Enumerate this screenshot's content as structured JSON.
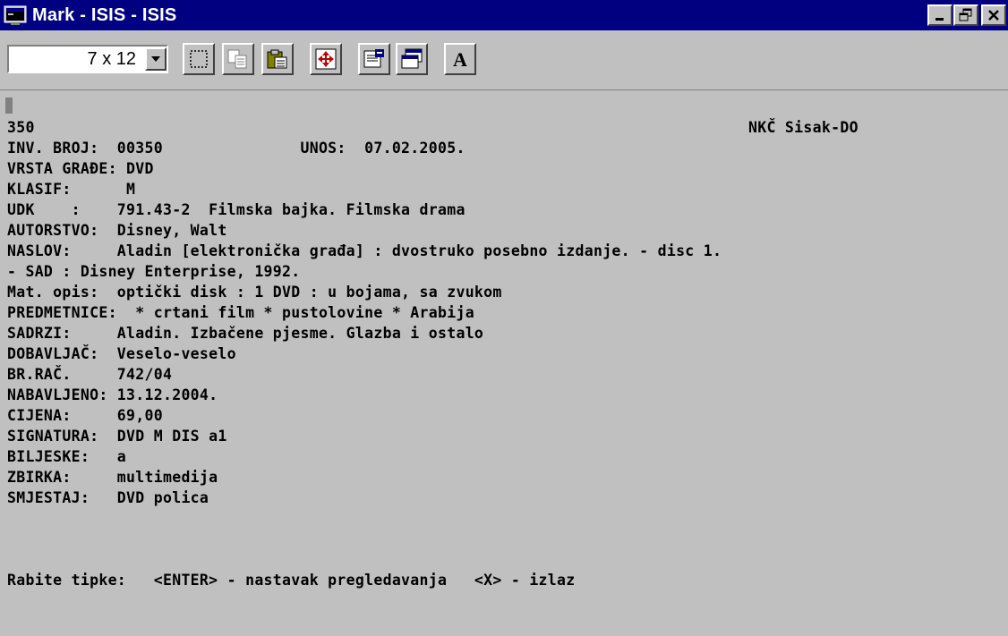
{
  "window": {
    "title": "Mark - ISIS - ISIS",
    "icon": "dos-window-icon"
  },
  "toolbar": {
    "font_size_value": "7 x 12",
    "buttons": [
      {
        "icon": "mark-select-icon"
      },
      {
        "icon": "copy-icon"
      },
      {
        "icon": "paste-icon"
      },
      {
        "icon": "fullscreen-icon"
      },
      {
        "icon": "properties-icon"
      },
      {
        "icon": "background-icon"
      },
      {
        "icon": "font-icon",
        "label": "A"
      }
    ]
  },
  "record": {
    "header_left": "350",
    "header_right": "NKČ Sisak-DO",
    "lines": [
      "INV. BROJ:  00350               UNOS:  07.02.2005.",
      "VRSTA GRAĐE: DVD",
      "KLASIF:      M",
      "UDK    :    791.43-2  Filmska bajka. Filmska drama",
      "AUTORSTVO:  Disney, Walt",
      "NASLOV:     Aladin [elektronička građa] : dvostruko posebno izdanje. - disc 1.",
      "- SAD : Disney Enterprise, 1992.",
      "Mat. opis:  optički disk : 1 DVD : u bojama, sa zvukom",
      "PREDMETNICE:  * crtani film * pustolovine * Arabija",
      "SADRZI:     Aladin. Izbačene pjesme. Glazba i ostalo",
      "DOBAVLJAČ:  Veselo-veselo",
      "BR.RAČ.     742/04",
      "NABAVLJENO: 13.12.2004.",
      "CIJENA:     69,00",
      "SIGNATURA:  DVD M DIS a1",
      "BILJESKE:   a",
      "ZBIRKA:     multimedija",
      "SMJESTAJ:   DVD polica"
    ],
    "footer": "Rabite tipke:   <ENTER> - nastavak pregledavanja   <X> - izlaz"
  }
}
